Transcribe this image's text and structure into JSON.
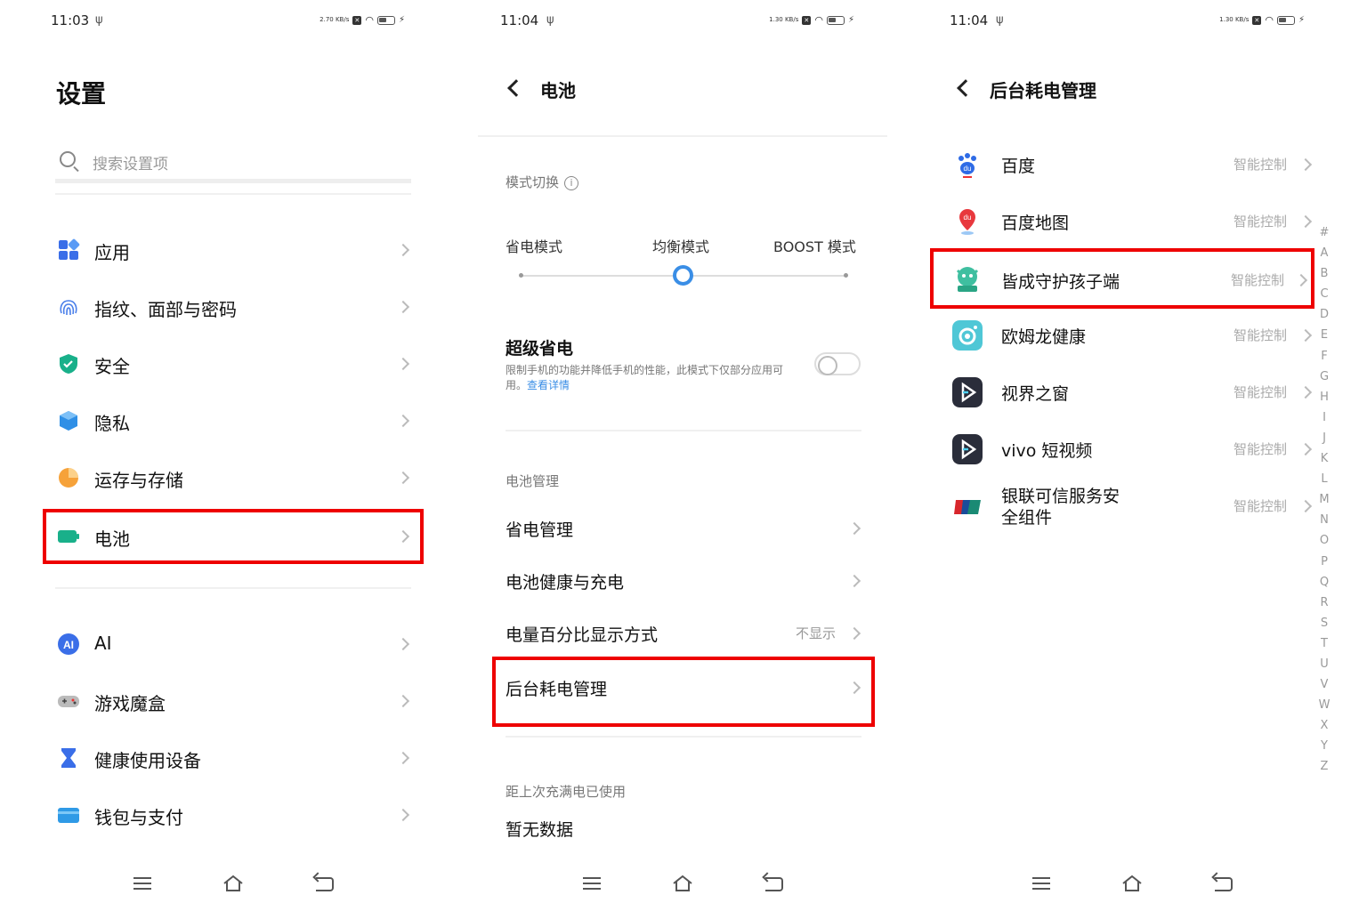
{
  "panel1": {
    "status": {
      "time": "11:03",
      "speed": "2.70 KB/s"
    },
    "title": "设置",
    "search_placeholder": "搜索设置项",
    "items": [
      {
        "label": "应用",
        "icon": "apps-grid-icon"
      },
      {
        "label": "指纹、面部与密码",
        "icon": "fingerprint-icon"
      },
      {
        "label": "安全",
        "icon": "shield-check-icon"
      },
      {
        "label": "隐私",
        "icon": "privacy-cube-icon"
      },
      {
        "label": "运存与存储",
        "icon": "storage-pie-icon"
      },
      {
        "label": "电池",
        "icon": "battery-icon"
      },
      {
        "label": "AI",
        "icon": "ai-badge-icon"
      },
      {
        "label": "游戏魔盒",
        "icon": "gamepad-icon"
      },
      {
        "label": "健康使用设备",
        "icon": "hourglass-icon"
      },
      {
        "label": "钱包与支付",
        "icon": "wallet-icon"
      }
    ]
  },
  "panel2": {
    "status": {
      "time": "11:04",
      "speed": "1.30 KB/s"
    },
    "header_title": "电池",
    "mode_section": "模式切换",
    "modes": [
      "省电模式",
      "均衡模式",
      "BOOST 模式"
    ],
    "super_title": "超级省电",
    "super_desc": "限制手机的功能并降低手机的性能，此模式下仅部分应用可用。",
    "super_link": "查看详情",
    "battery_section": "电池管理",
    "rows": [
      {
        "label": "省电管理",
        "value": ""
      },
      {
        "label": "电池健康与充电",
        "value": ""
      },
      {
        "label": "电量百分比显示方式",
        "value": "不显示"
      },
      {
        "label": "后台耗电管理",
        "value": ""
      }
    ],
    "usage_section": "距上次充满电已使用",
    "no_data": "暂无数据"
  },
  "panel3": {
    "status": {
      "time": "11:04",
      "speed": "1.30 KB/s"
    },
    "header_title": "后台耗电管理",
    "apps": [
      {
        "label": "百度",
        "status": "智能控制",
        "icon": "baidu-icon"
      },
      {
        "label": "百度地图",
        "status": "智能控制",
        "icon": "baidu-map-icon"
      },
      {
        "label": "皆成守护孩子端",
        "status": "智能控制",
        "icon": "child-guard-icon"
      },
      {
        "label": "欧姆龙健康",
        "status": "智能控制",
        "icon": "omron-icon"
      },
      {
        "label": "视界之窗",
        "status": "智能控制",
        "icon": "video-window-icon"
      },
      {
        "label": "vivo 短视频",
        "status": "智能控制",
        "icon": "vivo-video-icon"
      },
      {
        "label": "银联可信服务安全组件",
        "status": "智能控制",
        "icon": "unionpay-icon"
      }
    ],
    "index": [
      "#",
      "A",
      "B",
      "C",
      "D",
      "E",
      "F",
      "G",
      "H",
      "I",
      "J",
      "K",
      "L",
      "M",
      "N",
      "O",
      "P",
      "Q",
      "R",
      "S",
      "T",
      "U",
      "V",
      "W",
      "X",
      "Y",
      "Z"
    ]
  },
  "colors": {
    "highlight": "#e00000",
    "accent": "#3a8ee6"
  }
}
